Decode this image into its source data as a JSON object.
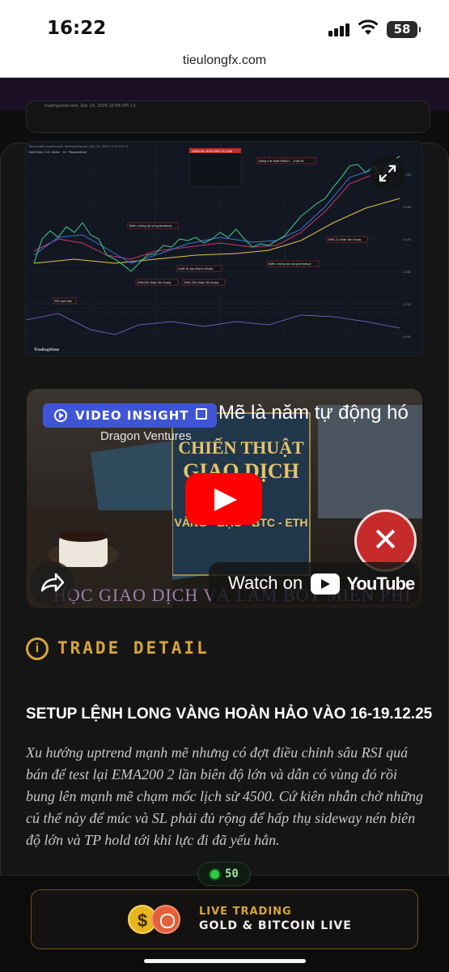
{
  "status": {
    "time": "16:22",
    "battery": "58"
  },
  "browser": {
    "url": "tieulongfx.com"
  },
  "behind_card": {
    "caption": "tradingview.com, Dec 24, 2025 10:54 UTC+1"
  },
  "chart_image": {
    "header": "TieuLongFX created with TradingView.com, Dec 24, 2025 10:53 UTC+1",
    "symbol": "Gold Spot / U.S. Dollar · 1h · Pepperstone",
    "panel_title": "DRAGON VENTURES SS LINK",
    "annotations": [
      "Đóng cửa dưới EMA21 - Chốt lời",
      "Kiểm chứng lại vùng breakout",
      "EMA 21 được tôn trọng",
      "Quét SL tạo thanh khoản",
      "EMA200 được tôn trọng",
      "EMA 200 được tôn trọng",
      "Kiểm chứng lại vùng breakout",
      "RSI quá bán"
    ],
    "brand": "TradingView",
    "price_labels": [
      "4,500",
      "4,460",
      "4,420",
      "4,380",
      "4,340",
      "4,300"
    ]
  },
  "video": {
    "badge": "VIDEO INSIGHT",
    "title": "Mẽ là năm tự động hó",
    "channel": "Dragon Ventures",
    "overlay": "HỌC GIAO DỊCH VÀ LÀM BOT MIỄN PHÍ",
    "watch_label": "Watch on",
    "watch_brand": "YouTube"
  },
  "trade": {
    "section_title": "TRADE DETAIL",
    "setup_title": "SETUP LỆNH LONG VÀNG HOÀN HẢO VÀO 16-19.12.25",
    "description": "Xu hướng uptrend mạnh mẽ nhưng có đợt điều chỉnh sâu RSI quá bán để test lại EMA200 2 lần biên độ lớn và dẫn có vùng đó rồi bung lên mạnh mẽ chạm mốc lịch sử 4500. Cứ kiên nhẫn chờ những cú thế này để múc và SL phải đủ rộng để hấp thụ sideway nén biên độ lớn và TP hold tới khi lực đi đã yếu hẳn."
  },
  "online": {
    "count": "50"
  },
  "live": {
    "line1": "LIVE TRADING",
    "line2": "GOLD & BITCOIN LIVE",
    "coin_symbol": "$"
  },
  "colors": {
    "accent_gold": "#d7a63a",
    "badge_blue": "#3f55d6",
    "youtube_red": "#ff0000",
    "online_green": "#2ecc40"
  }
}
